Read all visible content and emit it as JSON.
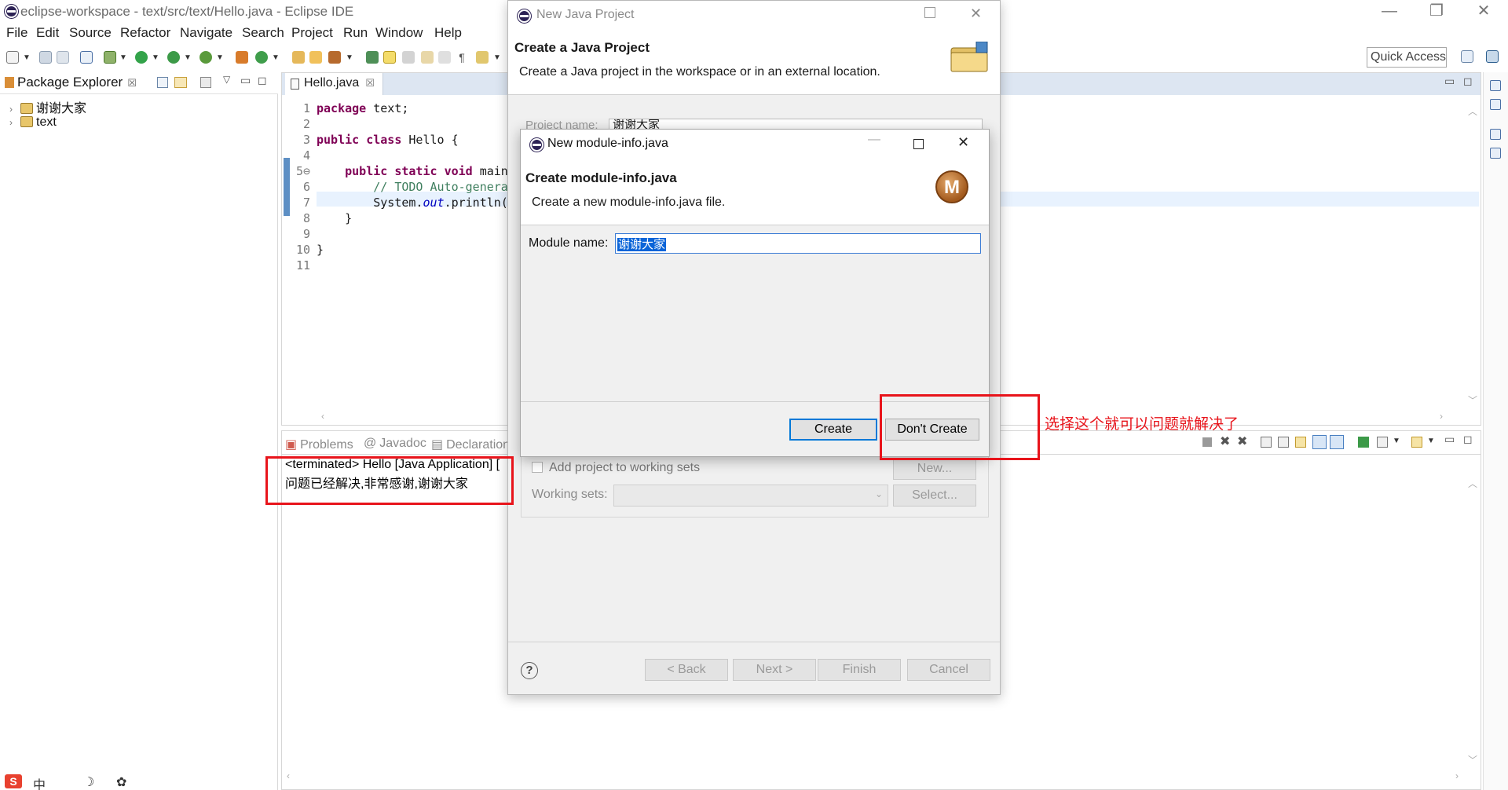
{
  "window": {
    "title": "eclipse-workspace - text/src/text/Hello.java - Eclipse IDE",
    "controls": [
      "—",
      "❐",
      "✕"
    ]
  },
  "menu": [
    "File",
    "Edit",
    "Source",
    "Refactor",
    "Navigate",
    "Search",
    "Project",
    "Run",
    "Window",
    "Help"
  ],
  "toolbar": {
    "quick_access": "Quick Access"
  },
  "package_explorer": {
    "tab_label": "Package Explorer",
    "items": [
      {
        "label": "谢谢大家"
      },
      {
        "label": "text"
      }
    ]
  },
  "editor": {
    "tab_label": "Hello.java",
    "lines": [
      {
        "n": "1",
        "parts": [
          [
            "kw",
            "package"
          ],
          [
            "",
            " text;"
          ]
        ]
      },
      {
        "n": "2",
        "parts": []
      },
      {
        "n": "3",
        "parts": [
          [
            "kw",
            "public"
          ],
          [
            "",
            " "
          ],
          [
            "kw",
            "class"
          ],
          [
            "",
            " Hello {"
          ]
        ]
      },
      {
        "n": "4",
        "parts": []
      },
      {
        "n": "5⊖",
        "parts": [
          [
            "",
            "    "
          ],
          [
            "kw",
            "public"
          ],
          [
            "",
            " "
          ],
          [
            "kw",
            "static"
          ],
          [
            "",
            " "
          ],
          [
            "kw",
            "void"
          ],
          [
            "",
            " main"
          ]
        ]
      },
      {
        "n": "6",
        "parts": [
          [
            "",
            "        "
          ],
          [
            "cm",
            "// TODO Auto-genera"
          ]
        ]
      },
      {
        "n": "7",
        "parts": [
          [
            "",
            "        System."
          ],
          [
            "fld",
            "out"
          ],
          [
            "",
            ".println("
          ]
        ]
      },
      {
        "n": "8",
        "parts": [
          [
            "",
            "    }"
          ]
        ]
      },
      {
        "n": "9",
        "parts": []
      },
      {
        "n": "10",
        "parts": [
          [
            "",
            "}"
          ]
        ]
      },
      {
        "n": "11",
        "parts": []
      }
    ]
  },
  "console": {
    "tabs": [
      "Problems",
      "Javadoc",
      "Declaration"
    ],
    "line1": "<terminated> Hello [Java Application] [",
    "line2": "问题已经解决,非常感谢,谢谢大家"
  },
  "annotation": {
    "text": "选择这个就可以问题就解决了"
  },
  "outer_dialog": {
    "title": "New Java Project",
    "heading": "Create a Java Project",
    "description": "Create a Java project in the workspace or in an external location.",
    "project_name_label": "Project name:",
    "project_name_value": "谢谢大家",
    "add_working_sets_label": "Add project to working sets",
    "new_button": "New...",
    "working_sets_label": "Working sets:",
    "select_button": "Select...",
    "back_button": "< Back",
    "next_button": "Next >",
    "finish_button": "Finish",
    "cancel_button": "Cancel",
    "help": "?"
  },
  "inner_dialog": {
    "title": "New module-info.java",
    "heading": "Create module-info.java",
    "description": "Create a new module-info.java file.",
    "module_name_label": "Module name:",
    "module_name_value": "谢谢大家",
    "create_button": "Create",
    "dont_create_button": "Don't Create",
    "icon_letter": "M"
  }
}
